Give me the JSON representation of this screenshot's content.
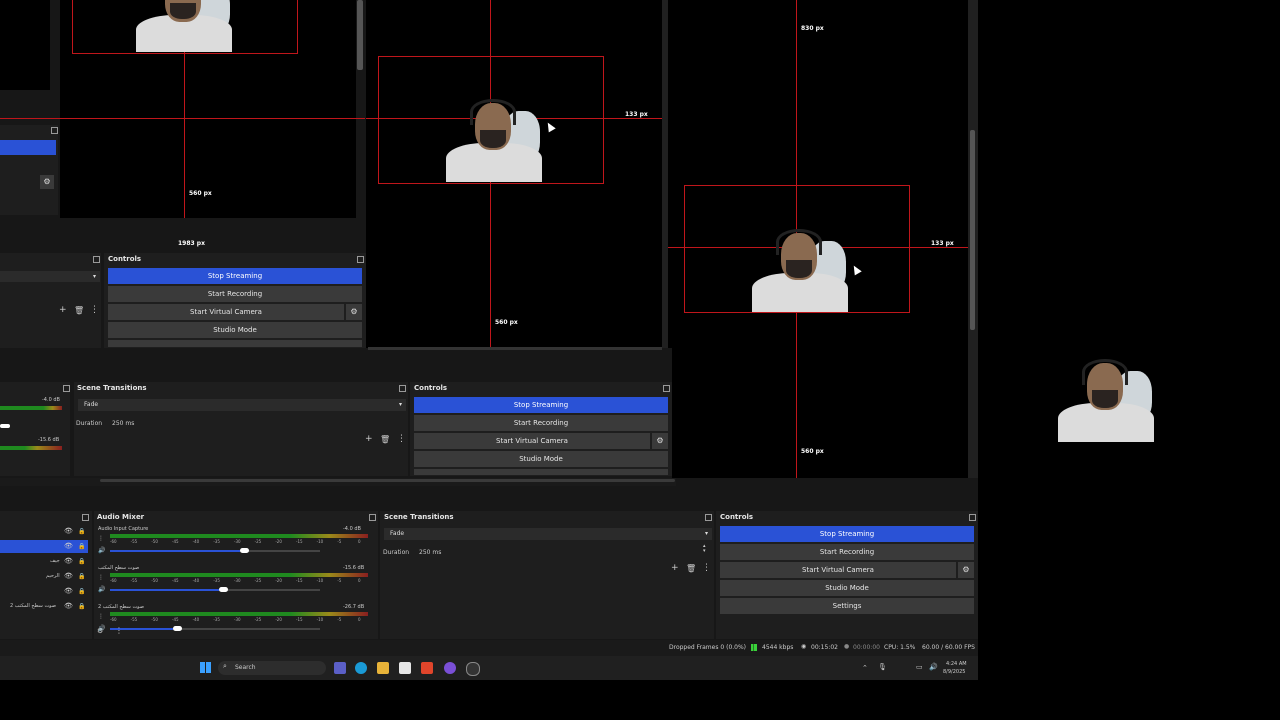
{
  "canvas": {
    "px_labels": [
      "830 px",
      "133 px",
      "560 px",
      "1983 px",
      "560 px",
      "133 px",
      "560 px"
    ]
  },
  "controls": {
    "title": "Controls",
    "stop_streaming": "Stop Streaming",
    "start_recording": "Start Recording",
    "start_virtual_camera": "Start Virtual Camera",
    "studio_mode": "Studio Mode",
    "settings": "Settings"
  },
  "scene_transitions": {
    "title": "Scene Transitions",
    "transition": "Fade",
    "duration_label": "Duration",
    "duration_value": "250 ms"
  },
  "audio_mixer": {
    "title": "Audio Mixer",
    "tracks": [
      {
        "name": "Audio Input Capture",
        "db": "-4.0 dB",
        "level": 0.62
      },
      {
        "name": "صوت سطح المكتب",
        "db": "-15.6 dB",
        "level": 0.52
      },
      {
        "name": "صوت سطح المكتب 2",
        "db": "-26.7 dB",
        "level": 0.3
      }
    ],
    "scale": [
      "-60",
      "-55",
      "-50",
      "-45",
      "-40",
      "-35",
      "-30",
      "-25",
      "-20",
      "-15",
      "-10",
      "-5",
      "0"
    ]
  },
  "mid_audio": {
    "db1": "-4.0 dB",
    "db2": "-15.6 dB"
  },
  "sources": {
    "items": [
      "جيف",
      "الرحيم",
      "صوت سطح المكتب 2"
    ]
  },
  "status": {
    "dropped": "Dropped Frames 0 (0.0%)",
    "kbps": "4544 kbps",
    "live_time": "00:15:02",
    "rec_time": "00:00:00",
    "cpu": "CPU: 1.5%",
    "fps": "60.00 / 60.00 FPS"
  },
  "taskbar": {
    "search": "Search",
    "time": "4:24 AM",
    "date": "8/9/2025"
  },
  "colors": {
    "accent": "#2a52d6",
    "red": "#c0161b",
    "panel": "#1e1e1e"
  }
}
